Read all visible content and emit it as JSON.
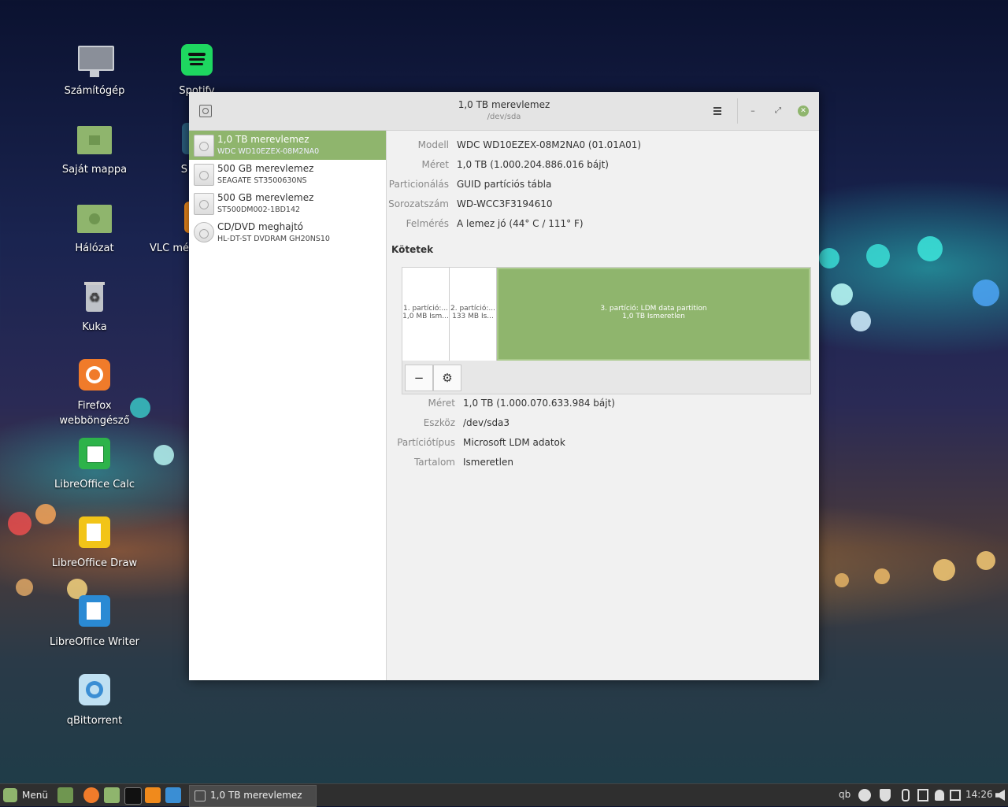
{
  "desktop": {
    "icons": [
      {
        "label": "Számítógép",
        "icon": "computer-icon"
      },
      {
        "label": "Spotify",
        "icon": "spotify-icon"
      },
      {
        "label": "Saját mappa",
        "icon": "home-folder-icon"
      },
      {
        "label": "S",
        "icon": "app-icon"
      },
      {
        "label": "Hálózat",
        "icon": "network-folder-icon"
      },
      {
        "label": "VLC mé",
        "icon": "vlc-icon"
      },
      {
        "label": "Kuka",
        "icon": "trash-icon"
      },
      {
        "label": "Firefox webböngésző",
        "icon": "firefox-icon"
      },
      {
        "label": "LibreOffice Calc",
        "icon": "libreoffice-calc-icon"
      },
      {
        "label": "LibreOffice Draw",
        "icon": "libreoffice-draw-icon"
      },
      {
        "label": "LibreOffice Writer",
        "icon": "libreoffice-writer-icon"
      },
      {
        "label": "qBittorrent",
        "icon": "qbittorrent-icon"
      }
    ]
  },
  "window": {
    "title": "1,0 TB merevlemez",
    "subtitle": "/dev/sda",
    "menu_icon": "hamburger-menu-icon",
    "minimize": "–",
    "restore": "⤢",
    "close": "✕"
  },
  "drives": [
    {
      "name": "1,0 TB merevlemez",
      "model": "WDC WD10EZEX-08M2NA0",
      "icon": "hard-disk-icon",
      "selected": true
    },
    {
      "name": "500 GB merevlemez",
      "model": "SEAGATE ST3500630NS",
      "icon": "hard-disk-icon",
      "selected": false
    },
    {
      "name": "500 GB merevlemez",
      "model": "ST500DM002-1BD142",
      "icon": "hard-disk-icon",
      "selected": false
    },
    {
      "name": "CD/DVD meghajtó",
      "model": "HL-DT-ST DVDRAM GH20NS10",
      "icon": "optical-drive-icon",
      "selected": false
    }
  ],
  "disk_info": {
    "model_label": "Modell",
    "model_value": "WDC WD10EZEX-08M2NA0 (01.01A01)",
    "size_label": "Méret",
    "size_value": "1,0 TB (1.000.204.886.016 bájt)",
    "partitioning_label": "Particionálás",
    "partitioning_value": "GUID partíciós tábla",
    "serial_label": "Sorozatszám",
    "serial_value": "WD-WCC3F3194610",
    "assessment_label": "Felmérés",
    "assessment_value": "A lemez jó (44° C / 111° F)"
  },
  "volumes": {
    "heading": "Kötetek",
    "partitions": [
      {
        "line1": "1. partíció:...",
        "line2": "1,0 MB Ism..."
      },
      {
        "line1": "2. partíció:...",
        "line2": "133 MB Is..."
      },
      {
        "line1": "3. partíció: LDM data partition",
        "line2": "1,0 TB Ismeretlen"
      }
    ],
    "remove_button": "−",
    "settings_button": "⚙"
  },
  "partition_info": {
    "size_label": "Méret",
    "size_value": "1,0 TB (1.000.070.633.984 bájt)",
    "device_label": "Eszköz",
    "device_value": "/dev/sda3",
    "type_label": "Partíciótípus",
    "type_value": "Microsoft LDM adatok",
    "content_label": "Tartalom",
    "content_value": "Ismeretlen"
  },
  "taskbar": {
    "menu_label": "Menü",
    "task_label": "1,0 TB merevlemez",
    "tray_qb": "qb",
    "clock": "14:26"
  },
  "colors": {
    "accent": "#8fb56d"
  }
}
